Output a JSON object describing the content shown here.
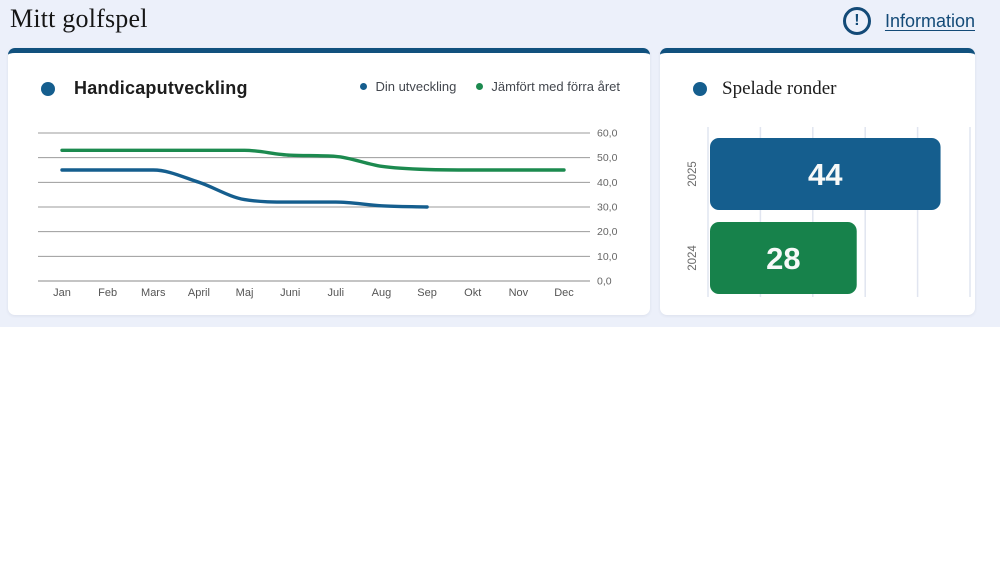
{
  "header": {
    "title": "Mitt golfspel",
    "info_label": "Information"
  },
  "colors": {
    "band_bg": "#ecf0fa",
    "card_top_border": "#11517e",
    "link_navy": "#134a77",
    "accent_blue": "#155e8e",
    "accent_green": "#17824b",
    "gridline_gray": "#9b9b9b",
    "bar_gridline": "#e1e5f0"
  },
  "handicap_card": {
    "title": "Handicaputveckling",
    "legend": [
      {
        "label": "Din utveckling",
        "color": "#155e8e"
      },
      {
        "label": "Jämfört med förra året",
        "color": "#1c8a4f"
      }
    ]
  },
  "rounds_card": {
    "title": "Spelade ronder"
  },
  "chart_data": [
    {
      "id": "handicap-line-chart",
      "type": "line",
      "title": "Handicaputveckling",
      "categories": [
        "Jan",
        "Feb",
        "Mars",
        "April",
        "Maj",
        "Juni",
        "Juli",
        "Aug",
        "Sep",
        "Okt",
        "Nov",
        "Dec"
      ],
      "series": [
        {
          "name": "Din utveckling",
          "color": "#155e8e",
          "values": [
            45,
            45,
            45,
            40,
            33,
            32,
            32,
            30.5,
            30,
            null,
            null,
            null
          ]
        },
        {
          "name": "Jämfört med förra året",
          "color": "#1c8a4f",
          "values": [
            53,
            53,
            53,
            53,
            53,
            51,
            50.5,
            46.5,
            45.2,
            45,
            45,
            45
          ]
        }
      ],
      "ylim": [
        0,
        60
      ],
      "ytick_step": 10,
      "ytick_labels": [
        "0,0",
        "10,0",
        "20,0",
        "30,0",
        "40,0",
        "50,0",
        "60,0"
      ],
      "grid": true,
      "legend_position": "top-right",
      "smoothing": "monotone"
    },
    {
      "id": "rounds-bar-chart",
      "type": "bar",
      "orientation": "horizontal",
      "title": "Spelade ronder",
      "categories": [
        "2025",
        "2024"
      ],
      "values": [
        44,
        28
      ],
      "value_labels": [
        "44",
        "28"
      ],
      "bar_colors": [
        "#155e8e",
        "#17824b"
      ],
      "xlim": [
        0,
        50
      ],
      "xtick_step": 10,
      "grid": true
    }
  ]
}
